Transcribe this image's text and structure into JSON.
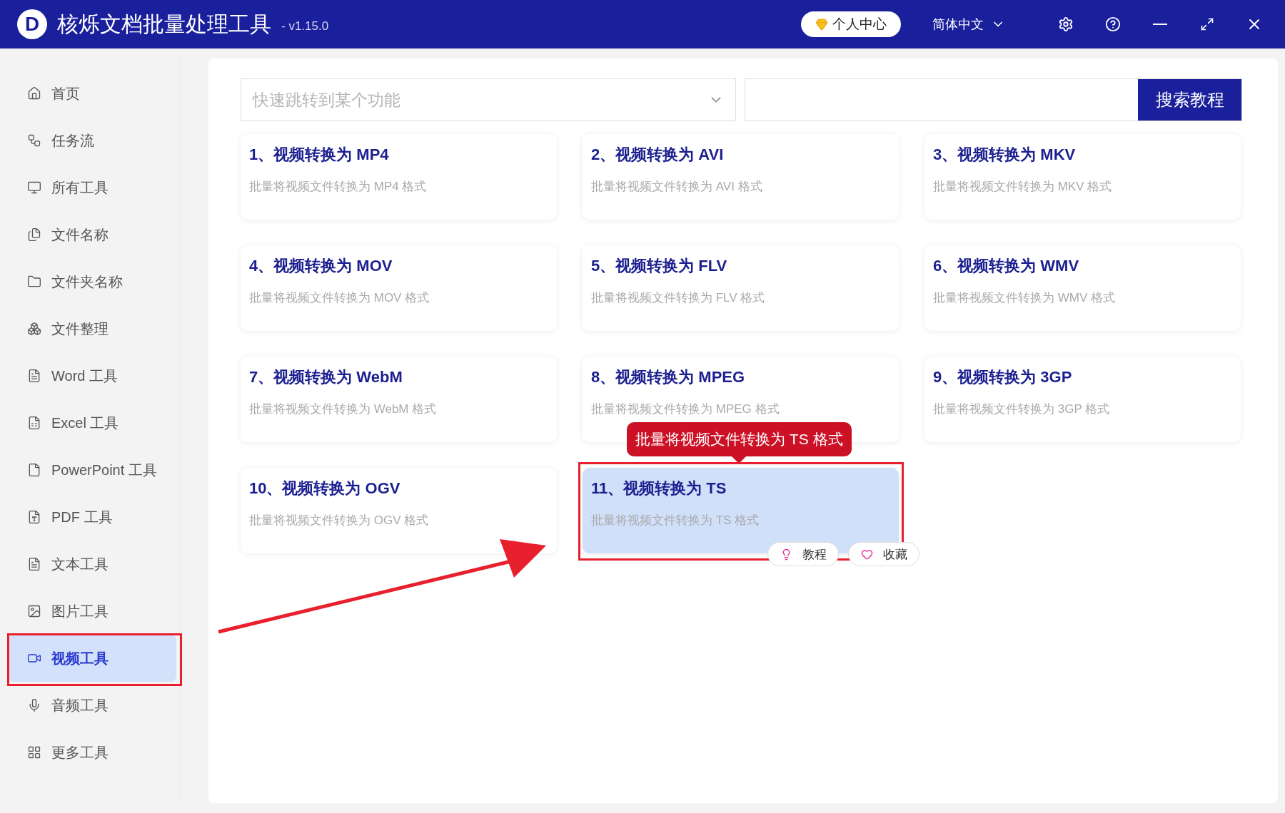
{
  "window": {
    "logo": "D",
    "title": "核烁文档批量处理工具",
    "version": "- v1.15.0",
    "user_button": "个人中心",
    "language": "简体中文"
  },
  "sidebar": {
    "items": [
      {
        "label": "首页",
        "selected": false
      },
      {
        "label": "任务流",
        "selected": false
      },
      {
        "label": "所有工具",
        "selected": false
      },
      {
        "label": "文件名称",
        "selected": false
      },
      {
        "label": "文件夹名称",
        "selected": false
      },
      {
        "label": "文件整理",
        "selected": false
      },
      {
        "label": "Word 工具",
        "selected": false
      },
      {
        "label": "Excel 工具",
        "selected": false
      },
      {
        "label": "PowerPoint 工具",
        "selected": false
      },
      {
        "label": "PDF 工具",
        "selected": false
      },
      {
        "label": "文本工具",
        "selected": false
      },
      {
        "label": "图片工具",
        "selected": false
      },
      {
        "label": "视频工具",
        "selected": true
      },
      {
        "label": "音频工具",
        "selected": false
      },
      {
        "label": "更多工具",
        "selected": false
      }
    ]
  },
  "search": {
    "placeholder": "快速跳转到某个功能",
    "button": "搜索教程"
  },
  "tools": [
    {
      "title": "1、视频转换为 MP4",
      "description": "批量将视频文件转换为 MP4 格式",
      "selected": false
    },
    {
      "title": "2、视频转换为 AVI",
      "description": "批量将视频文件转换为 AVI 格式",
      "selected": false
    },
    {
      "title": "3、视频转换为 MKV",
      "description": "批量将视频文件转换为 MKV 格式",
      "selected": false
    },
    {
      "title": "4、视频转换为 MOV",
      "description": "批量将视频文件转换为 MOV 格式",
      "selected": false
    },
    {
      "title": "5、视频转换为 FLV",
      "description": "批量将视频文件转换为 FLV 格式",
      "selected": false
    },
    {
      "title": "6、视频转换为 WMV",
      "description": "批量将视频文件转换为 WMV 格式",
      "selected": false
    },
    {
      "title": "7、视频转换为 WebM",
      "description": "批量将视频文件转换为 WebM 格式",
      "selected": false
    },
    {
      "title": "8、视频转换为 MPEG",
      "description": "批量将视频文件转换为 MPEG 格式",
      "selected": false
    },
    {
      "title": "9、视频转换为 3GP",
      "description": "批量将视频文件转换为 3GP 格式",
      "selected": false
    },
    {
      "title": "10、视频转换为 OGV",
      "description": "批量将视频文件转换为 OGV 格式",
      "selected": false
    },
    {
      "title": "11、视频转换为 TS",
      "description": "批量将视频文件转换为 TS 格式",
      "selected": true,
      "actions": [
        "教程",
        "收藏"
      ]
    }
  ],
  "tooltip": "批量将视频文件转换为 TS 格式"
}
